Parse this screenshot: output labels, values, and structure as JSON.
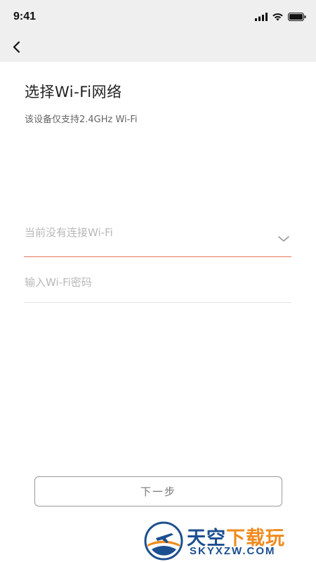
{
  "status_bar": {
    "time": "9:41",
    "icons": [
      "signal-icon",
      "wifi-icon",
      "battery-icon"
    ]
  },
  "nav": {
    "back_icon": "chevron-left-icon"
  },
  "page": {
    "title": "选择Wi-Fi网络",
    "subtitle": "该设备仅支持2.4GHz Wi-Fi"
  },
  "wifi_select": {
    "placeholder": "当前没有连接Wi-Fi",
    "icon": "chevron-down-icon",
    "underline_color": "#e8755f"
  },
  "password": {
    "placeholder": "输入Wi-Fi密码",
    "value": ""
  },
  "actions": {
    "next_label": "下一步"
  },
  "watermark": {
    "title_part1": "天空",
    "title_part2": "下载玩",
    "url": "SKYXZW.COM",
    "colors": {
      "blue": "#1c4f8f",
      "orange": "#f08a1c"
    }
  }
}
